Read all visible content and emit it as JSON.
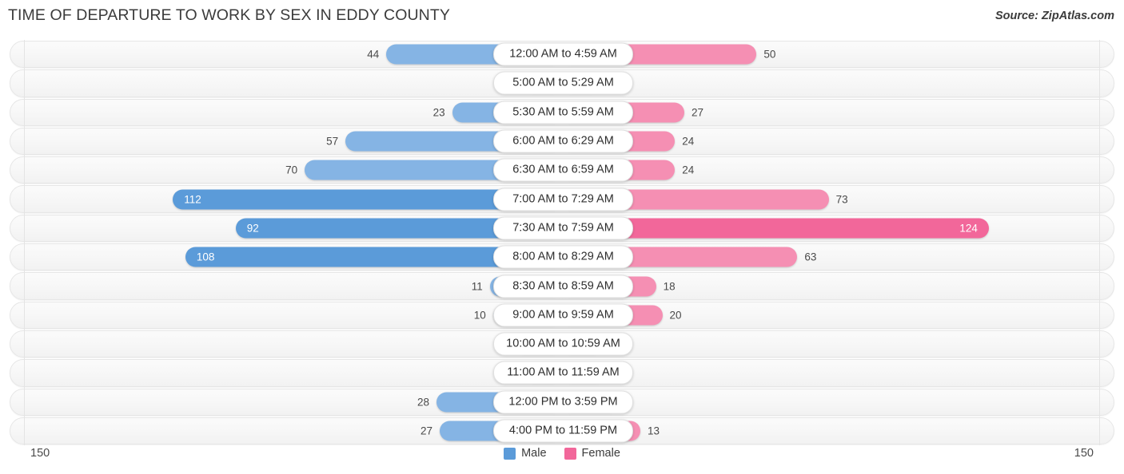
{
  "title": "TIME OF DEPARTURE TO WORK BY SEX IN EDDY COUNTY",
  "source": "Source: ZipAtlas.com",
  "legend": {
    "male_label": "Male",
    "female_label": "Female",
    "male_color": "#5b9bd9",
    "female_color": "#f2679a"
  },
  "axis": {
    "left_max": "150",
    "right_max": "150",
    "max_value": 150
  },
  "colors": {
    "male_light": "#85b4e4",
    "male_dark": "#5b9bd9",
    "female_light": "#f58fb3",
    "female_dark": "#f2679a"
  },
  "chart_data": {
    "type": "bar",
    "title": "TIME OF DEPARTURE TO WORK BY SEX IN EDDY COUNTY",
    "xlabel": "",
    "ylabel": "",
    "orientation": "horizontal-diverging",
    "xlim": [
      0,
      150
    ],
    "grid": false,
    "legend_position": "bottom-center",
    "categories": [
      "12:00 AM to 4:59 AM",
      "5:00 AM to 5:29 AM",
      "5:30 AM to 5:59 AM",
      "6:00 AM to 6:29 AM",
      "6:30 AM to 6:59 AM",
      "7:00 AM to 7:29 AM",
      "7:30 AM to 7:59 AM",
      "8:00 AM to 8:29 AM",
      "8:30 AM to 8:59 AM",
      "9:00 AM to 9:59 AM",
      "10:00 AM to 10:59 AM",
      "11:00 AM to 11:59 AM",
      "12:00 PM to 3:59 PM",
      "4:00 PM to 11:59 PM"
    ],
    "series": [
      {
        "name": "Male",
        "values": [
          44,
          0,
          23,
          57,
          70,
          112,
          92,
          108,
          11,
          10,
          3,
          0,
          28,
          27
        ]
      },
      {
        "name": "Female",
        "values": [
          50,
          0,
          27,
          24,
          24,
          73,
          124,
          63,
          18,
          20,
          1,
          2,
          6,
          13
        ]
      }
    ]
  },
  "rows": [
    {
      "label": "12:00 AM to 4:59 AM",
      "male": "44",
      "female": "50"
    },
    {
      "label": "5:00 AM to 5:29 AM",
      "male": "0",
      "female": "0"
    },
    {
      "label": "5:30 AM to 5:59 AM",
      "male": "23",
      "female": "27"
    },
    {
      "label": "6:00 AM to 6:29 AM",
      "male": "57",
      "female": "24"
    },
    {
      "label": "6:30 AM to 6:59 AM",
      "male": "70",
      "female": "24"
    },
    {
      "label": "7:00 AM to 7:29 AM",
      "male": "112",
      "female": "73"
    },
    {
      "label": "7:30 AM to 7:59 AM",
      "male": "92",
      "female": "124"
    },
    {
      "label": "8:00 AM to 8:29 AM",
      "male": "108",
      "female": "63"
    },
    {
      "label": "8:30 AM to 8:59 AM",
      "male": "11",
      "female": "18"
    },
    {
      "label": "9:00 AM to 9:59 AM",
      "male": "10",
      "female": "20"
    },
    {
      "label": "10:00 AM to 10:59 AM",
      "male": "3",
      "female": "1"
    },
    {
      "label": "11:00 AM to 11:59 AM",
      "male": "0",
      "female": "2"
    },
    {
      "label": "12:00 PM to 3:59 PM",
      "male": "28",
      "female": "6"
    },
    {
      "label": "4:00 PM to 11:59 PM",
      "male": "27",
      "female": "13"
    }
  ]
}
